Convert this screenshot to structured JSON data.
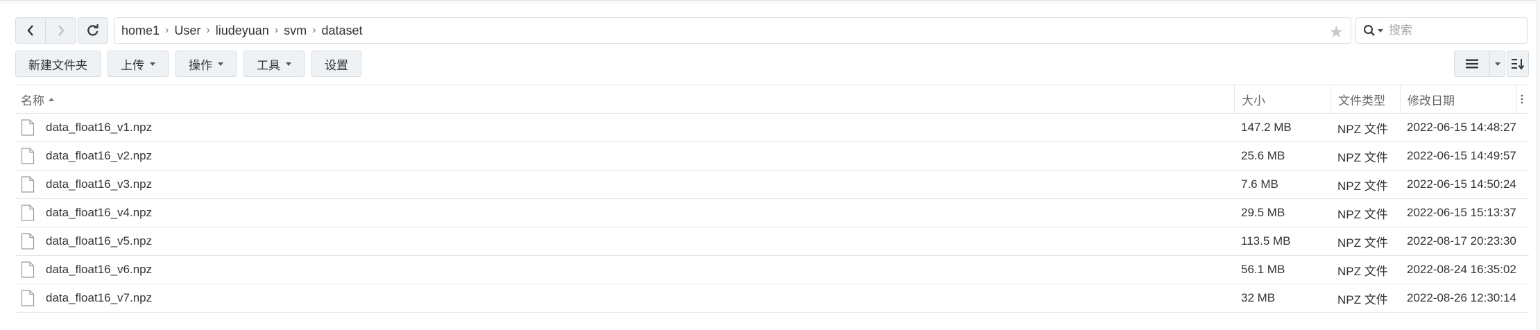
{
  "breadcrumb": [
    "home1",
    "User",
    "liudeyuan",
    "svm",
    "dataset"
  ],
  "search": {
    "placeholder": "搜索"
  },
  "toolbar": {
    "new_folder": "新建文件夹",
    "upload": "上传",
    "actions": "操作",
    "tools": "工具",
    "settings": "设置"
  },
  "columns": {
    "name": "名称",
    "size": "大小",
    "type": "文件类型",
    "modified": "修改日期"
  },
  "files": [
    {
      "name": "data_float16_v1.npz",
      "size": "147.2 MB",
      "type": "NPZ 文件",
      "modified": "2022-06-15 14:48:27"
    },
    {
      "name": "data_float16_v2.npz",
      "size": "25.6 MB",
      "type": "NPZ 文件",
      "modified": "2022-06-15 14:49:57"
    },
    {
      "name": "data_float16_v3.npz",
      "size": "7.6 MB",
      "type": "NPZ 文件",
      "modified": "2022-06-15 14:50:24"
    },
    {
      "name": "data_float16_v4.npz",
      "size": "29.5 MB",
      "type": "NPZ 文件",
      "modified": "2022-06-15 15:13:37"
    },
    {
      "name": "data_float16_v5.npz",
      "size": "113.5 MB",
      "type": "NPZ 文件",
      "modified": "2022-08-17 20:23:30"
    },
    {
      "name": "data_float16_v6.npz",
      "size": "56.1 MB",
      "type": "NPZ 文件",
      "modified": "2022-08-24 16:35:02"
    },
    {
      "name": "data_float16_v7.npz",
      "size": "32 MB",
      "type": "NPZ 文件",
      "modified": "2022-08-26 12:30:14"
    }
  ],
  "icons": {
    "back": "chevron-left-icon",
    "forward": "chevron-right-icon",
    "refresh": "refresh-icon",
    "favorite": "star-icon",
    "search": "search-icon",
    "list_view": "list-icon",
    "sort": "sort-icon",
    "file": "file-icon",
    "more": "more-vertical-icon"
  }
}
